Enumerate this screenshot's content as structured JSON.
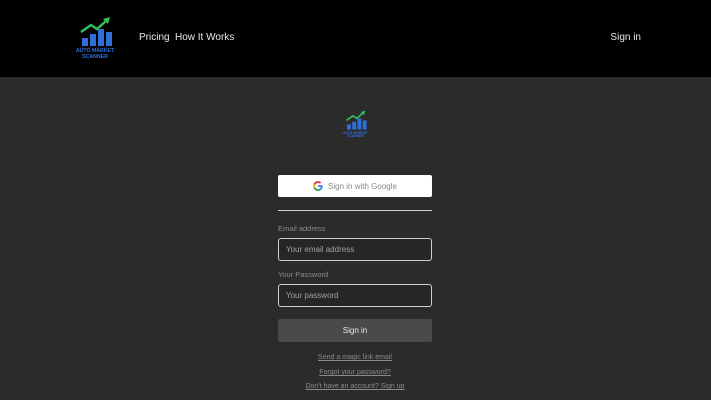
{
  "brand": {
    "name_line1": "AUTO MARKET",
    "name_line2": "SCANNER",
    "color": "#2f6fd6",
    "arrow_color": "#2fbf5a"
  },
  "nav": {
    "items": [
      {
        "label": "Pricing"
      },
      {
        "label": "How It Works"
      }
    ],
    "sign_in_label": "Sign in"
  },
  "auth": {
    "google_label": "Sign in with Google",
    "email_label": "Email address",
    "email_placeholder": "Your email address",
    "email_value": "",
    "password_label": "Your Password",
    "password_placeholder": "Your password",
    "password_value": "",
    "submit_label": "Sign in",
    "links": {
      "magic_link": "Send a magic link email",
      "forgot": "Forgot your password?",
      "signup": "Don't have an account? Sign up"
    }
  }
}
